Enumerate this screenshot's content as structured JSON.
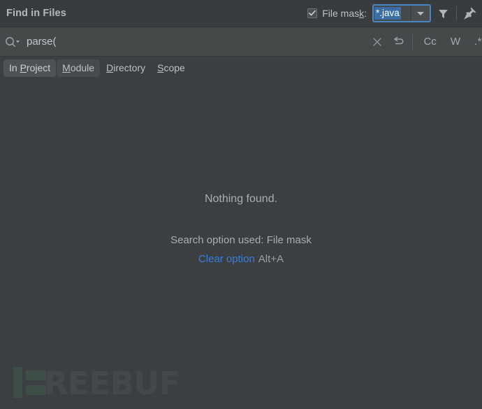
{
  "header": {
    "title": "Find in Files",
    "file_mask_label_pre": "File mas",
    "file_mask_label_mnemonic": "k",
    "file_mask_label_post": ":",
    "file_mask_checked": true,
    "file_mask_value": "*.java",
    "filter_icon": "filter-funnel-icon",
    "pin_icon": "pin-icon"
  },
  "search": {
    "value": "parse(",
    "placeholder": "",
    "magnifier_icon": "search-icon",
    "clear_icon": "close-icon",
    "history_icon": "reset-arrow-icon",
    "toggles": [
      {
        "name": "match-case",
        "label": "Cc"
      },
      {
        "name": "words",
        "label": "W"
      },
      {
        "name": "regex",
        "label": ".*"
      }
    ]
  },
  "tabs": [
    {
      "name": "in-project",
      "pre": "In ",
      "mnemonic": "P",
      "post": "roject",
      "state": "selected"
    },
    {
      "name": "module",
      "pre": "",
      "mnemonic": "M",
      "post": "odule",
      "state": "hover"
    },
    {
      "name": "directory",
      "pre": "",
      "mnemonic": "D",
      "post": "irectory",
      "state": "normal"
    },
    {
      "name": "scope",
      "pre": "",
      "mnemonic": "S",
      "post": "cope",
      "state": "normal"
    }
  ],
  "results": {
    "nothing_found": "Nothing found.",
    "option_used": "Search option used: File mask",
    "clear_link": "Clear option",
    "clear_shortcut": "Alt+A"
  },
  "watermark": {
    "text": "REEBUF",
    "mark_color": "#3e4f48",
    "text_color": "#45484a"
  },
  "colors": {
    "header_bg": "#393c3e",
    "search_bg": "#45494a",
    "content_bg": "#3c3f41",
    "accent_blue": "#4b86c4",
    "selection_blue": "#3a6ea5",
    "link_blue": "#3c7ed4"
  }
}
